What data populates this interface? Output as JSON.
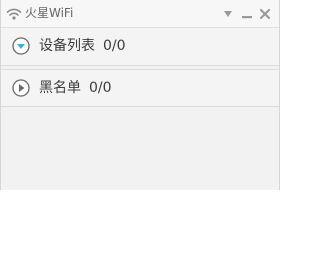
{
  "window": {
    "title": "火星WiFi",
    "controls": {
      "menu": "dropdown-menu",
      "minimize": "minimize",
      "close": "close"
    }
  },
  "sections": [
    {
      "label": "设备列表",
      "count": "0/0",
      "icon": "expanded-chevron-down-icon",
      "state": "expanded"
    },
    {
      "label": "黑名单",
      "count": "0/0",
      "icon": "collapsed-play-right-icon",
      "state": "collapsed"
    }
  ],
  "colors": {
    "accent": "#3ab0d8",
    "text": "#3c3c3c",
    "muted": "#666666"
  }
}
